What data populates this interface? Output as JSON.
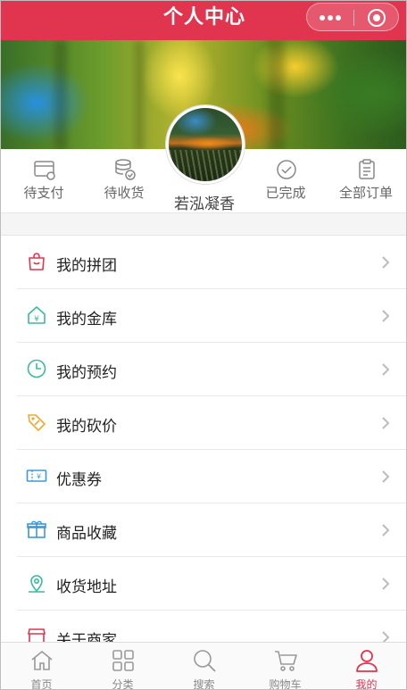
{
  "header": {
    "title": "个人中心",
    "brand_color": "#e0344f"
  },
  "user": {
    "nickname": "若泓凝香"
  },
  "orders": [
    {
      "label": "待支付",
      "icon": "wallet-card-icon"
    },
    {
      "label": "待收货",
      "icon": "coins-check-icon"
    },
    {
      "label": "已完成",
      "icon": "check-circle-icon"
    },
    {
      "label": "全部订单",
      "icon": "clipboard-icon"
    }
  ],
  "menu": [
    {
      "label": "我的拼团",
      "icon": "shopping-bag-icon",
      "color": "#e0344f"
    },
    {
      "label": "我的金库",
      "icon": "vault-house-icon",
      "color": "#3bb9a0"
    },
    {
      "label": "我的预约",
      "icon": "clock-icon",
      "color": "#3bb9a0"
    },
    {
      "label": "我的砍价",
      "icon": "price-tag-icon",
      "color": "#f0a830"
    },
    {
      "label": "优惠券",
      "icon": "coupon-icon",
      "color": "#3a9ad9"
    },
    {
      "label": "商品收藏",
      "icon": "gift-icon",
      "color": "#3a9ad9"
    },
    {
      "label": "收货地址",
      "icon": "location-pin-icon",
      "color": "#3bb9a0"
    },
    {
      "label": "关于商家",
      "icon": "store-icon",
      "color": "#e0344f"
    }
  ],
  "tabbar": [
    {
      "label": "首页",
      "icon": "home-icon",
      "active": false
    },
    {
      "label": "分类",
      "icon": "grid-icon",
      "active": false
    },
    {
      "label": "搜索",
      "icon": "search-icon",
      "active": false
    },
    {
      "label": "购物车",
      "icon": "cart-icon",
      "active": false
    },
    {
      "label": "我的",
      "icon": "user-icon",
      "active": true
    }
  ]
}
